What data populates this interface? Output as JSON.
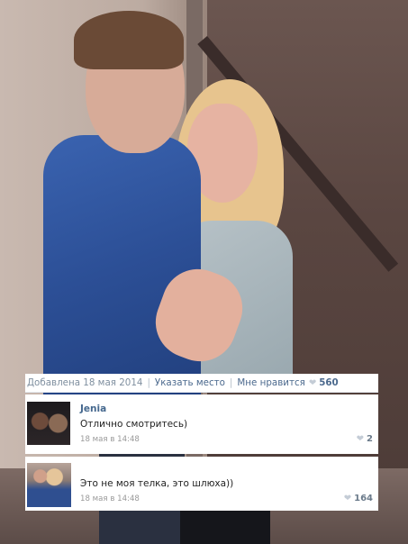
{
  "post_meta": {
    "added_label": "Добавлена 18 мая 2014",
    "location_link": "Указать место",
    "like_label": "Мне нравится",
    "like_count": "560",
    "separator": "|"
  },
  "comments": [
    {
      "author": "Jenia",
      "text": "Отлично смотритесь)",
      "time": "18 мая в 14:48",
      "likes": "2"
    },
    {
      "author": "",
      "text": "Это не моя телка, это шлюха))",
      "time": "18 мая в 14:48",
      "likes": "164"
    }
  ],
  "icons": {
    "heart": "heart-icon"
  },
  "colors": {
    "link": "#45688e",
    "meta_text": "#7f8f9f",
    "panel_bg": "#ffffff"
  }
}
